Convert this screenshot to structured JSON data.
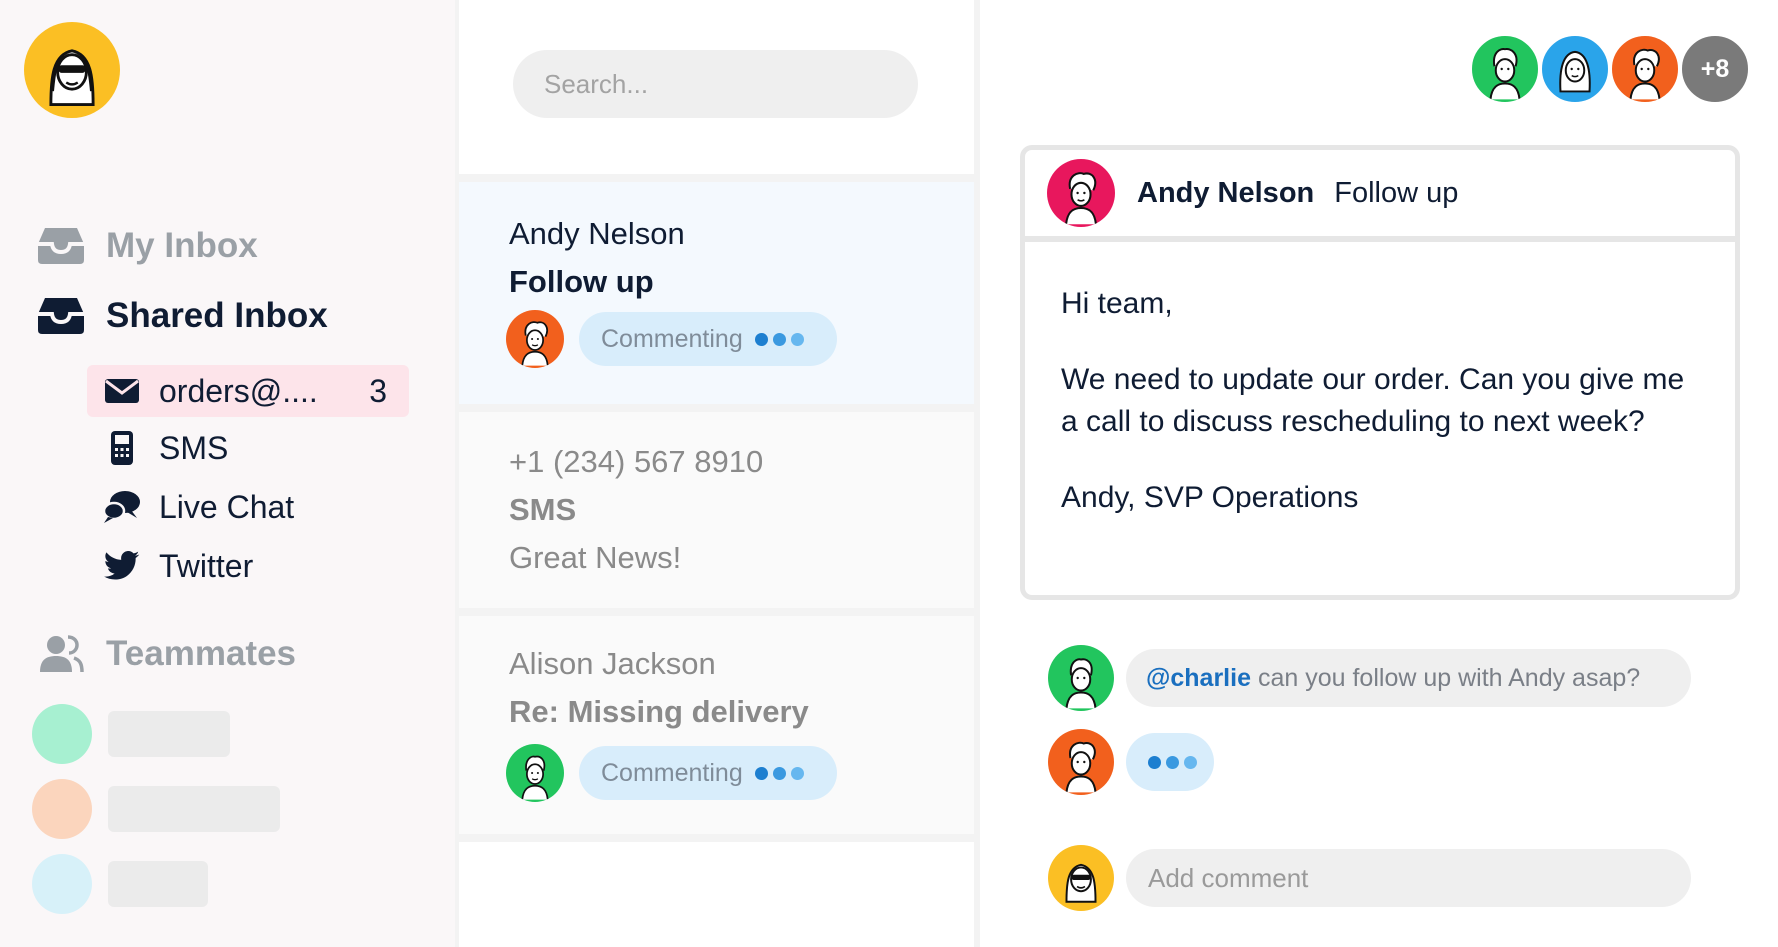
{
  "colors": {
    "sidebar_bg": "#faf7f8",
    "active_item_bg": "#fde4ea",
    "commenting_pill": "#d8edfb",
    "mention": "#1a6fbf",
    "dot_dark": "#1d7fd0",
    "dot_light": "#66b7ef",
    "more_badge": "#7a7a7a"
  },
  "sidebar": {
    "user_avatar": {
      "icon": "user-sunglasses-avatar",
      "bg": "#fbbf24"
    },
    "my_inbox": {
      "label": "My Inbox",
      "icon": "inbox-icon"
    },
    "shared_inbox": {
      "label": "Shared Inbox",
      "icon": "inbox-icon"
    },
    "sub_items": [
      {
        "label": "orders@....",
        "count": "3",
        "icon": "envelope-icon",
        "active": true
      },
      {
        "label": "SMS",
        "icon": "phone-icon"
      },
      {
        "label": "Live Chat",
        "icon": "chat-bubbles-icon"
      },
      {
        "label": "Twitter",
        "icon": "twitter-icon"
      }
    ],
    "teammates": {
      "label": "Teammates",
      "icon": "people-icon",
      "placeholders": [
        {
          "color": "#a7f0d1"
        },
        {
          "color": "#fbd5bd"
        },
        {
          "color": "#d7f1f9"
        }
      ]
    }
  },
  "middle": {
    "search": {
      "placeholder": "Search..."
    },
    "conversations": [
      {
        "name": "Andy Nelson",
        "subject": "Follow up",
        "status": "Commenting",
        "avatar_color": "#f2601d",
        "selected": true
      },
      {
        "name": "+1 (234) 567 8910",
        "subject": "SMS",
        "preview": "Great News!"
      },
      {
        "name": "Alison Jackson",
        "subject": "Re: Missing delivery",
        "status": "Commenting",
        "avatar_color": "#22c55e"
      }
    ]
  },
  "right": {
    "team_avatars": [
      {
        "color": "#22c55e",
        "icon": "teammate-avatar"
      },
      {
        "color": "#2aa4ea",
        "icon": "teammate-avatar"
      },
      {
        "color": "#f2601d",
        "icon": "teammate-avatar"
      }
    ],
    "more_count": "+8",
    "message": {
      "from": "Andy Nelson",
      "subject": "Follow up",
      "avatar_color": "#e8175d",
      "greeting": "Hi team,",
      "body": "We need to update our order. Can you give me a call to discuss rescheduling to next week?",
      "signature": "Andy, SVP Operations"
    },
    "comments": [
      {
        "mention": "@charlie",
        "text": "can you follow up with Andy asap?",
        "avatar_color": "#22c55e"
      },
      {
        "typing": true,
        "avatar_color": "#f2601d"
      }
    ],
    "add_comment": {
      "placeholder": "Add comment",
      "avatar_color": "#fbbf24"
    }
  }
}
